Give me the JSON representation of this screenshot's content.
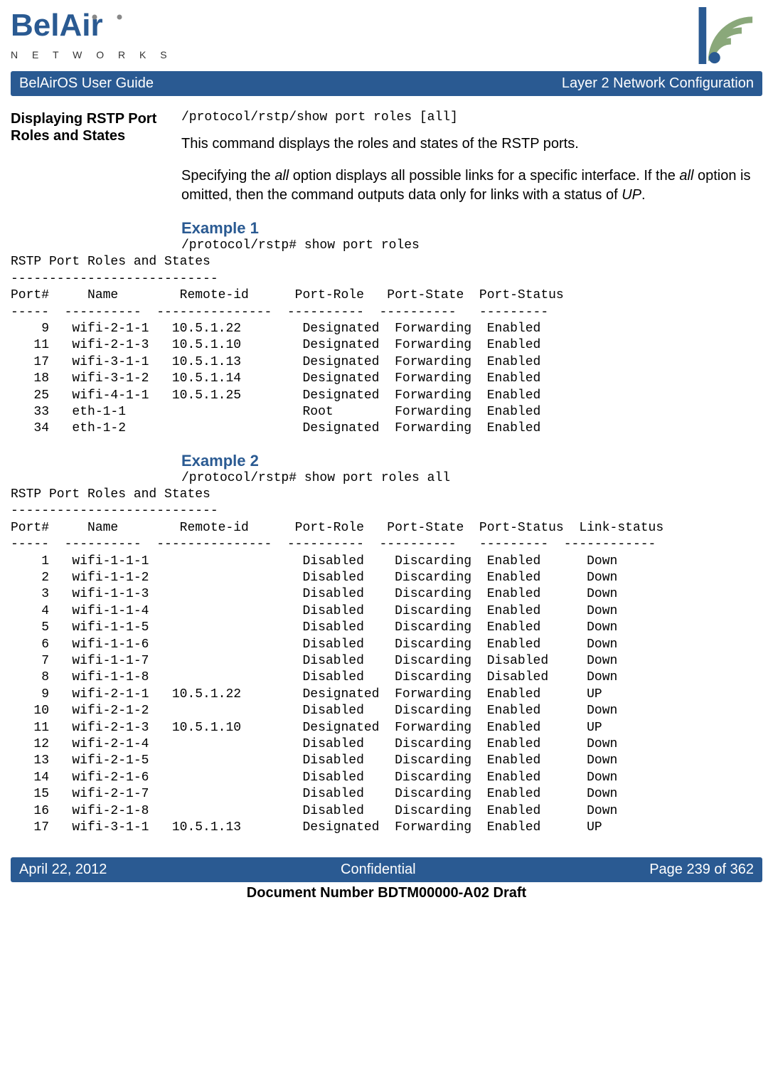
{
  "header": {
    "logo_main": "BelAir",
    "logo_sub": "N E T W O R K S",
    "title_left": "BelAirOS User Guide",
    "title_right": "Layer 2 Network Configuration"
  },
  "section": {
    "heading": "Displaying RSTP Port Roles and States",
    "command": "/protocol/rstp/show port roles [all]",
    "para1": "This command displays the roles and states of the RSTP ports.",
    "para2_pre": "Specifying the ",
    "para2_it1": "all",
    "para2_mid1": " option displays all possible links for a specific interface. If the ",
    "para2_it2": "all",
    "para2_mid2": " option is omitted, then the command outputs data only for links with a status of ",
    "para2_it3": "UP",
    "para2_end": "."
  },
  "example1": {
    "heading": "Example 1",
    "cmd": "/protocol/rstp# show port roles",
    "output": "RSTP Port Roles and States\n---------------------------\nPort#     Name        Remote-id      Port-Role   Port-State  Port-Status\n-----  ----------  ---------------  ----------  ----------   ---------\n    9   wifi-2-1-1   10.5.1.22        Designated  Forwarding  Enabled\n   11   wifi-2-1-3   10.5.1.10        Designated  Forwarding  Enabled\n   17   wifi-3-1-1   10.5.1.13        Designated  Forwarding  Enabled\n   18   wifi-3-1-2   10.5.1.14        Designated  Forwarding  Enabled\n   25   wifi-4-1-1   10.5.1.25        Designated  Forwarding  Enabled\n   33   eth-1-1                       Root        Forwarding  Enabled\n   34   eth-1-2                       Designated  Forwarding  Enabled"
  },
  "example2": {
    "heading": "Example 2",
    "cmd": "/protocol/rstp# show port roles all",
    "output": "RSTP Port Roles and States\n---------------------------\nPort#     Name        Remote-id      Port-Role   Port-State  Port-Status  Link-status\n-----  ----------  ---------------  ----------  ----------   ---------  ------------\n    1   wifi-1-1-1                    Disabled    Discarding  Enabled      Down\n    2   wifi-1-1-2                    Disabled    Discarding  Enabled      Down\n    3   wifi-1-1-3                    Disabled    Discarding  Enabled      Down\n    4   wifi-1-1-4                    Disabled    Discarding  Enabled      Down\n    5   wifi-1-1-5                    Disabled    Discarding  Enabled      Down\n    6   wifi-1-1-6                    Disabled    Discarding  Enabled      Down\n    7   wifi-1-1-7                    Disabled    Discarding  Disabled     Down\n    8   wifi-1-1-8                    Disabled    Discarding  Disabled     Down\n    9   wifi-2-1-1   10.5.1.22        Designated  Forwarding  Enabled      UP\n   10   wifi-2-1-2                    Disabled    Discarding  Enabled      Down\n   11   wifi-2-1-3   10.5.1.10        Designated  Forwarding  Enabled      UP\n   12   wifi-2-1-4                    Disabled    Discarding  Enabled      Down\n   13   wifi-2-1-5                    Disabled    Discarding  Enabled      Down\n   14   wifi-2-1-6                    Disabled    Discarding  Enabled      Down\n   15   wifi-2-1-7                    Disabled    Discarding  Enabled      Down\n   16   wifi-2-1-8                    Disabled    Discarding  Enabled      Down\n   17   wifi-3-1-1   10.5.1.13        Designated  Forwarding  Enabled      UP"
  },
  "footer": {
    "date": "April 22, 2012",
    "center": "Confidential",
    "page": "Page 239 of 362",
    "docnum": "Document Number BDTM00000-A02 Draft"
  }
}
